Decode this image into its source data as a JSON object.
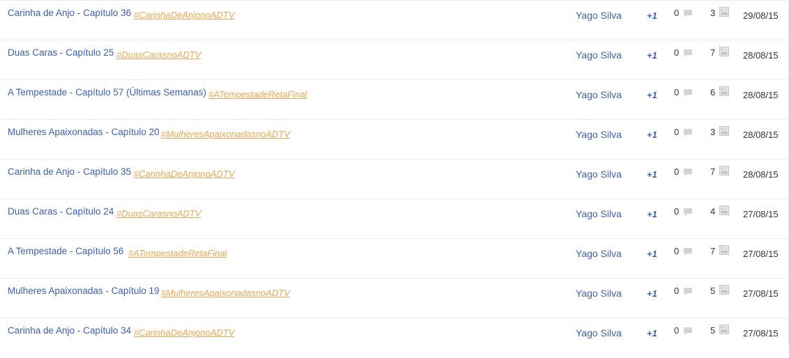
{
  "colors": {
    "title_link": "#3b5fb3",
    "hashtag": "#f0a650",
    "row_divider": "#ececec",
    "icon_gray": "#cfcfcf"
  },
  "icons": {
    "comment": "comment-bubble-icon",
    "image": "image-icon"
  },
  "rows": [
    {
      "title": "Carinha de Anjo - Capítulo 36",
      "hashtag": "#CarinhaDeAnjonoADTV",
      "author": "Yago Silva",
      "plus": "+1",
      "comments": "0",
      "views": "3",
      "date": "29/08/15"
    },
    {
      "title": "Duas Caras - Capítulo 25",
      "hashtag": "#DuasCarasnoADTV",
      "author": "Yago Silva",
      "plus": "+1",
      "comments": "0",
      "views": "7",
      "date": "28/08/15"
    },
    {
      "title": "A Tempestade - Capítulo 57 (Últimas Semanas)",
      "hashtag": "#ATempestadeRetaFinal",
      "author": "Yago Silva",
      "plus": "+1",
      "comments": "0",
      "views": "6",
      "date": "28/08/15"
    },
    {
      "title": "Mulheres Apaixonadas - Capítulo 20",
      "hashtag": "#MulheresApaixonadasnoADTV",
      "author": "Yago Silva",
      "plus": "+1",
      "comments": "0",
      "views": "3",
      "date": "28/08/15"
    },
    {
      "title": "Carinha de Anjo - Capítulo 35",
      "hashtag": "#CarinhaDeAnjonoADTV",
      "author": "Yago Silva",
      "plus": "+1",
      "comments": "0",
      "views": "7",
      "date": "28/08/15"
    },
    {
      "title": "Duas Caras - Capítulo 24",
      "hashtag": "#DuasCarasnoADTV",
      "author": "Yago Silva",
      "plus": "+1",
      "comments": "0",
      "views": "4",
      "date": "27/08/15"
    },
    {
      "title": "A Tempestade - Capítulo 56",
      "hashtag": "#ATempestadeRetaFinal",
      "author": "Yago Silva",
      "plus": "+1",
      "comments": "0",
      "views": "7",
      "date": "27/08/15"
    },
    {
      "title": "Mulheres Apaixonadas - Capítulo 19",
      "hashtag": "#MulheresApaixonadasnoADTV",
      "author": "Yago Silva",
      "plus": "+1",
      "comments": "0",
      "views": "5",
      "date": "27/08/15"
    },
    {
      "title": "Carinha de Anjo - Capítulo 34",
      "hashtag": "#CarinhaDeAnjonoADTV",
      "author": "Yago Silva",
      "plus": "+1",
      "comments": "0",
      "views": "5",
      "date": "27/08/15"
    }
  ]
}
